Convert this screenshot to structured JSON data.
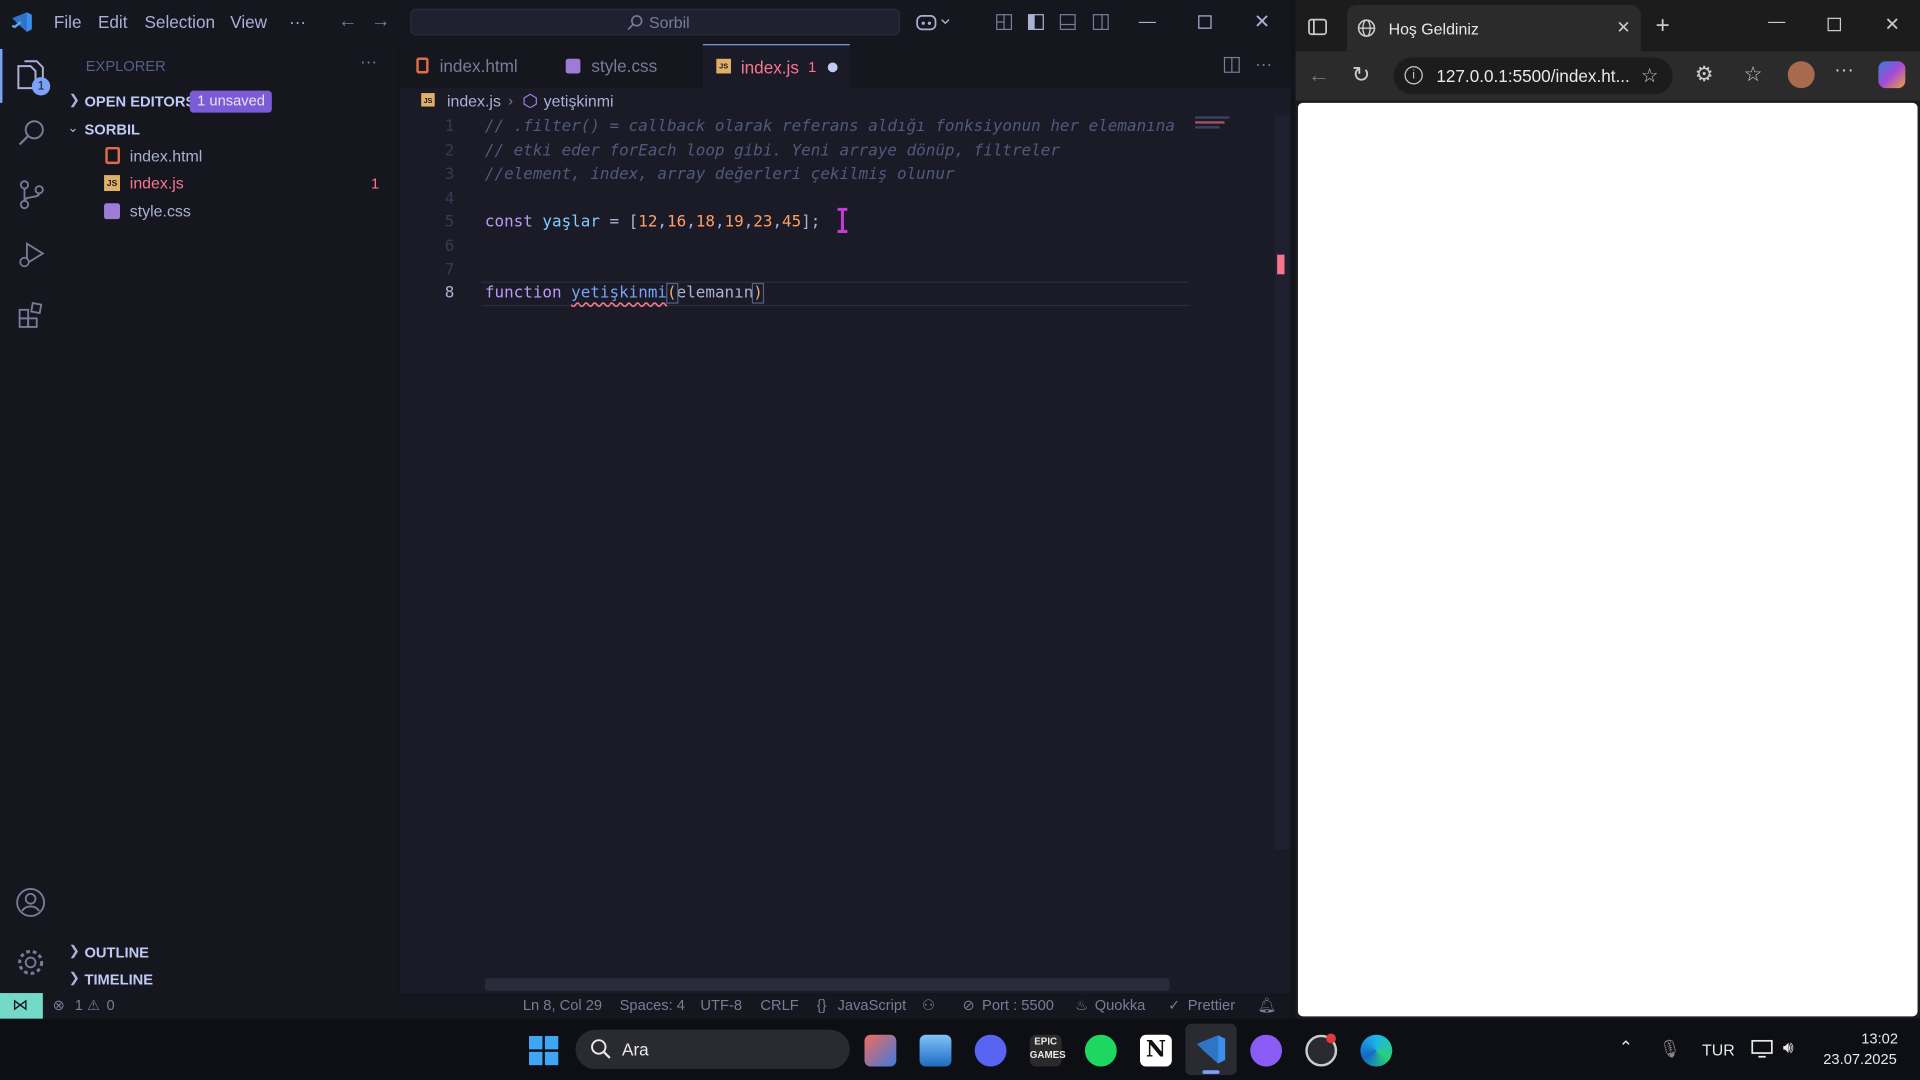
{
  "vscode": {
    "menu": [
      "File",
      "Edit",
      "Selection",
      "View",
      "···"
    ],
    "search_text": "Sorbil",
    "explorer_title": "EXPLORER",
    "open_editors": "OPEN EDITORS",
    "unsaved_badge": "1 unsaved",
    "folder": "SORBIL",
    "files": [
      {
        "name": "index.html",
        "color": "#e06c4a"
      },
      {
        "name": "index.js",
        "color": "#f7768e",
        "badge": "1"
      },
      {
        "name": "style.css",
        "color": "#a9b1d6"
      }
    ],
    "outline": "OUTLINE",
    "timeline": "TIMELINE",
    "explorer_badge": "1",
    "tabs": [
      {
        "label": "index.html"
      },
      {
        "label": "style.css"
      },
      {
        "label": "index.js",
        "badge": "1"
      }
    ],
    "breadcrumb": {
      "file": "index.js",
      "symbol": "yetişkinmi"
    },
    "line_numbers": [
      "1",
      "2",
      "3",
      "4",
      "5",
      "6",
      "7",
      "8"
    ],
    "code": {
      "l1": "// .filter() = callback olarak referans aldığı fonksiyonun her elemanına",
      "l2": "// etki eder forEach loop gibi. Yeni arraye dönüp, filtreler",
      "l3": "//element, index, array değerleri çekilmiş olunur",
      "l5_kw": "const",
      "l5_var": "yaşlar",
      "l5_eq": " = [",
      "l5_nums": [
        "12",
        "16",
        "18",
        "19",
        "23",
        "45"
      ],
      "l5_end": "];",
      "l8_kw": "function",
      "l8_fn": "yetişkinmi",
      "l8_open": "(",
      "l8_param": "elemanın",
      "l8_close": ")"
    },
    "status": {
      "errors": "1",
      "warnings": "0",
      "position": "Ln 8, Col 29",
      "spaces": "Spaces: 4",
      "encoding": "UTF-8",
      "eol": "CRLF",
      "language": "JavaScript",
      "port": "Port : 5500",
      "quokka": "Quokka",
      "prettier": "Prettier"
    }
  },
  "browser": {
    "tab_title": "Hoş Geldiniz",
    "url": "127.0.0.1:5500/index.ht..."
  },
  "taskbar": {
    "search": "Ara",
    "lang": "TUR",
    "time": "13:02",
    "date": "23.07.2025"
  },
  "colors": {
    "accent": "#7aa2f7",
    "vscode_bg": "#1a1b26",
    "sidebar_bg": "#16161e",
    "status_remote": "#73daca"
  }
}
